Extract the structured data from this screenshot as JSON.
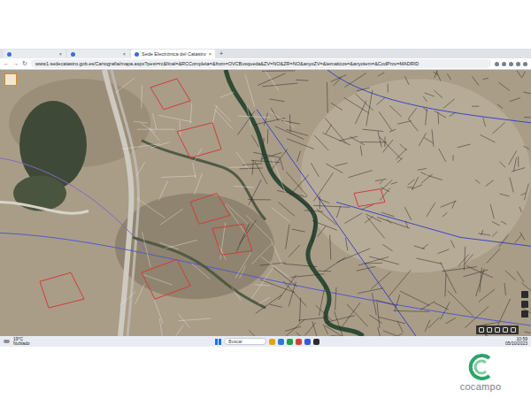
{
  "browser": {
    "tabs": [
      {
        "label": "",
        "selected": false
      },
      {
        "label": "",
        "selected": false
      },
      {
        "label": "Sede Electrónica del Catastro",
        "selected": true
      }
    ],
    "tab_close": "×",
    "new_tab": "+",
    "nav_buttons": [
      "←",
      "→",
      "↻"
    ],
    "address": "www1.sedecatastro.gob.es/Cartografia/mapa.aspx?pest=rc&final=&RCCompleta=&from=OVCBusqueda&ZV=NO&ZR=NO&anyoZV=&tematicos=&anyotem=&CodProv=MADRID"
  },
  "taskbar": {
    "weather": {
      "temp": "19°C",
      "text": "Nublado"
    },
    "search": {
      "placeholder": "Buscar"
    },
    "clock": {
      "time": "10:59",
      "date": "05/10/2023"
    }
  },
  "logo": {
    "text": "cocampo"
  }
}
